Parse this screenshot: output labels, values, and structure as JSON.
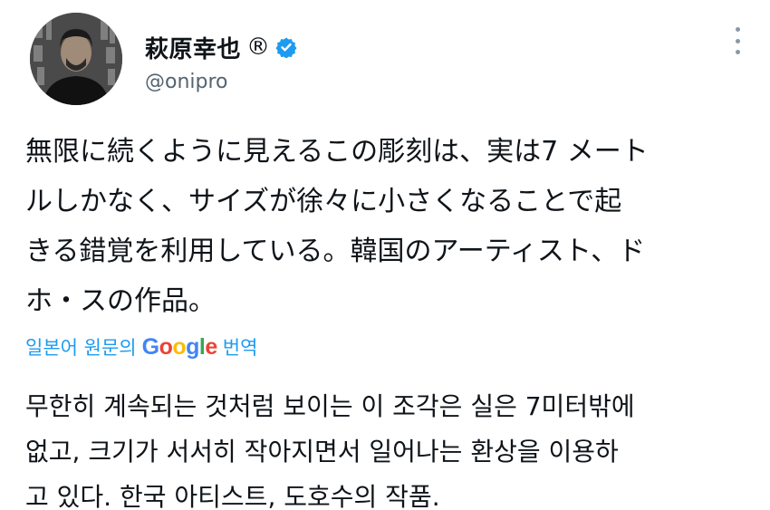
{
  "author": {
    "display_name": "萩原幸也",
    "registered_mark": "®",
    "handle": "@onipro"
  },
  "tweet": {
    "lines": [
      "無限に続くように見えるこの彫刻は、実は7 メート",
      "ルしかなく、サイズが徐々に小さくなることで起",
      "きる錯覚を利用している。韓国のアーティスト、ド",
      "ホ・スの作品。"
    ]
  },
  "translation": {
    "prefix": "일본어 원문의",
    "provider": [
      "G",
      "o",
      "o",
      "g",
      "l",
      "e"
    ],
    "suffix": "번역",
    "lines": [
      "무한히 계속되는 것처럼 보이는 이 조각은 실은 7미터밖에",
      "없고, 크기가 서서히 작아지면서 일어나는 환상을 이용하",
      "고 있다. 한국 아티스트, 도호수의 작품."
    ]
  },
  "colors": {
    "accent": "#1d9bf0",
    "text": "#0f1419",
    "muted": "#536471"
  },
  "icons": {
    "verified": "verified-badge-icon",
    "more": "more-options-icon"
  }
}
